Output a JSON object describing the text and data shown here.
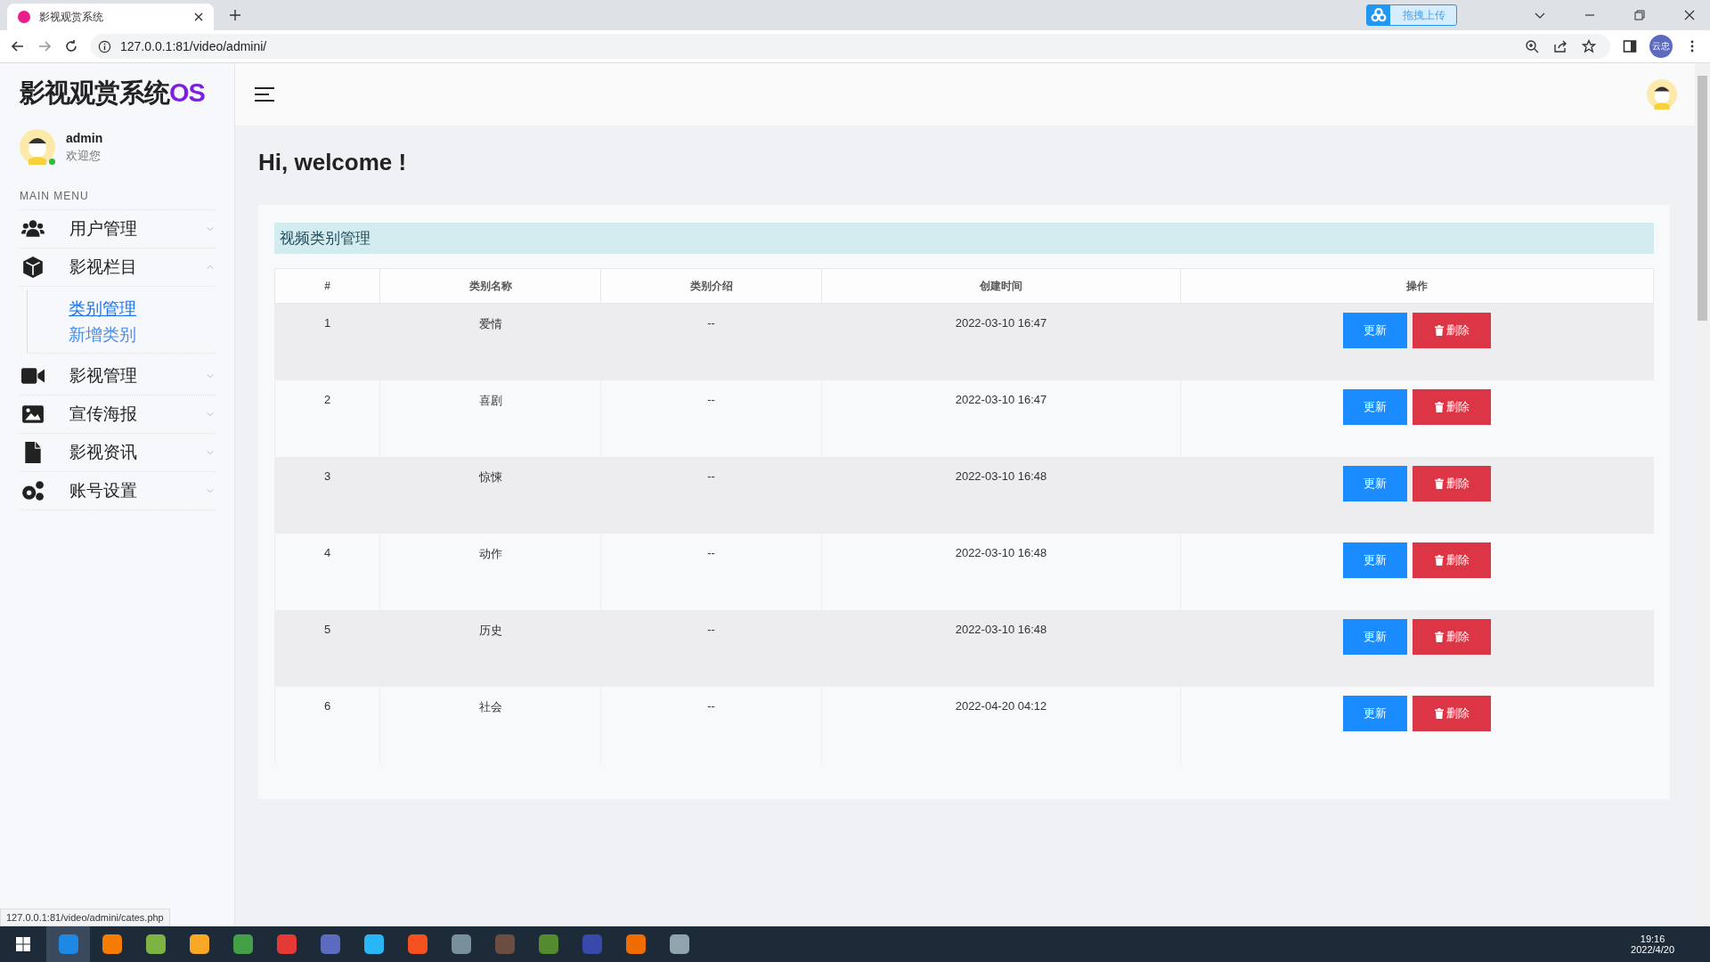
{
  "browser": {
    "tab_title": "影视观赏系统",
    "url": "127.0.0.1:81/video/admini/",
    "upload_button": "拖拽上传",
    "profile": "云忠",
    "status_url": "127.0.0.1:81/video/admini/cates.php"
  },
  "sidebar": {
    "logo": "影视观赏系统",
    "logo_suffix": "OS",
    "user": {
      "name": "admin",
      "greeting": "欢迎您",
      "online": true
    },
    "menu_title": "MAIN MENU",
    "items": [
      {
        "label": "用户管理",
        "expanded": false
      },
      {
        "label": "影视栏目",
        "expanded": true,
        "children": [
          {
            "label": "类别管理",
            "selected": true
          },
          {
            "label": "新增类别",
            "selected": false
          }
        ]
      },
      {
        "label": "影视管理",
        "expanded": false
      },
      {
        "label": "宣传海报",
        "expanded": false
      },
      {
        "label": "影视资讯",
        "expanded": false
      },
      {
        "label": "账号设置",
        "expanded": false
      }
    ]
  },
  "heading": "Hi, welcome !",
  "panel_title": "视频类别管理",
  "table": {
    "columns": [
      "#",
      "类别名称",
      "类别介绍",
      "创建时间",
      "操作"
    ],
    "rows": [
      {
        "index": "1",
        "name": "爱情",
        "intro": "--",
        "created": "2022-03-10 16:47",
        "update": "更新",
        "delete": "删除"
      },
      {
        "index": "2",
        "name": "喜剧",
        "intro": "--",
        "created": "2022-03-10 16:47",
        "update": "更新",
        "delete": "删除"
      },
      {
        "index": "3",
        "name": "惊悚",
        "intro": "--",
        "created": "2022-03-10 16:48",
        "update": "更新",
        "delete": "删除"
      },
      {
        "index": "4",
        "name": "动作",
        "intro": "--",
        "created": "2022-03-10 16:48",
        "update": "更新",
        "delete": "删除"
      },
      {
        "index": "5",
        "name": "历史",
        "intro": "--",
        "created": "2022-03-10 16:48",
        "update": "更新",
        "delete": "删除"
      },
      {
        "index": "6",
        "name": "社会",
        "intro": "--",
        "created": "2022-04-20 04:12",
        "update": "更新",
        "delete": "删除"
      }
    ]
  },
  "taskbar": {
    "time": "19:16",
    "date": "2022/4/20"
  }
}
